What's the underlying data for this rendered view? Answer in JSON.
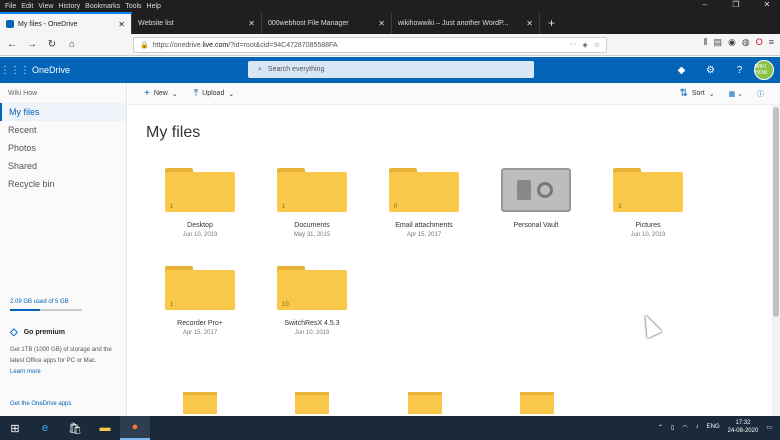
{
  "menu": [
    "File",
    "Edit",
    "View",
    "History",
    "Bookmarks",
    "Tools",
    "Help"
  ],
  "tabs": [
    {
      "label": "My files - OneDrive",
      "active": true
    },
    {
      "label": "Website list",
      "active": false
    },
    {
      "label": "000webhost File Manager",
      "active": false
    },
    {
      "label": "wikihowwiki – Just another WordP...",
      "active": false
    }
  ],
  "url": {
    "prefix": "https://onedrive.",
    "domain": "live.com",
    "rest": "/?id=root&cid=94C47287085588FA"
  },
  "onedrive": {
    "brand": "OneDrive",
    "search_placeholder": "Search everything",
    "avatar_label": "WIKI HOW"
  },
  "sidebar": {
    "user": "Wiki How",
    "items": [
      "My files",
      "Recent",
      "Photos",
      "Shared",
      "Recycle bin"
    ],
    "storage": "2.09 GB used of 5 GB",
    "storage_fraction": 0.42,
    "premium_title": "Go premium",
    "premium_text": "Get 1TB (1000 GB) of storage and the latest Office apps for PC or Mac.",
    "learn_more": "Learn more",
    "get_apps": "Get the OneDrive apps"
  },
  "commands": {
    "new": "New",
    "upload": "Upload",
    "sort": "Sort"
  },
  "heading": "My files",
  "folders": [
    {
      "name": "Desktop",
      "date": "Jun 10, 2019",
      "count": "1"
    },
    {
      "name": "Documents",
      "date": "May 31, 2015",
      "count": "1"
    },
    {
      "name": "Email attachments",
      "date": "Apr 15, 2017",
      "count": "0"
    },
    {
      "name": "Personal Vault",
      "date": ""
    },
    {
      "name": "Pictures",
      "date": "Jun 10, 2019",
      "count": "3"
    },
    {
      "name": "Recorder Pro+",
      "date": "Apr 15, 2017",
      "count": "1"
    },
    {
      "name": "SwitchResX 4.5.3",
      "date": "Jun 10, 2019",
      "count": "10"
    }
  ],
  "tray": {
    "lang": "ENG",
    "time": "17:32",
    "date": "24-08-2020"
  }
}
